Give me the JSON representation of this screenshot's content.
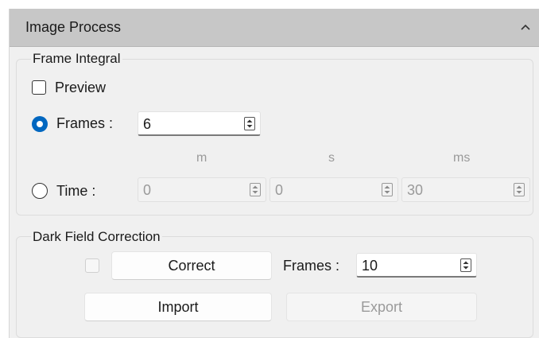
{
  "panel": {
    "title": "Image Process",
    "collapse_icon": "chevron-up-icon"
  },
  "frame_integral": {
    "title": "Frame Integral",
    "preview": {
      "label": "Preview",
      "checked": false
    },
    "frames_option": {
      "label": "Frames :",
      "selected": true,
      "value": "6"
    },
    "time_units": {
      "minutes": "m",
      "seconds": "s",
      "milliseconds": "ms"
    },
    "time_option": {
      "label": "Time :",
      "selected": false,
      "minutes": "0",
      "seconds": "0",
      "milliseconds": "30"
    }
  },
  "dark_field": {
    "title": "Dark Field Correction",
    "enable_checked": false,
    "correct_label": "Correct",
    "frames_label": "Frames :",
    "frames_value": "10",
    "import_label": "Import",
    "export_label": "Export"
  },
  "colors": {
    "header_bg": "#c7c7c7",
    "panel_bg": "#f0f0f0",
    "accent": "#0067c0",
    "disabled_text": "#9a9a9a"
  }
}
